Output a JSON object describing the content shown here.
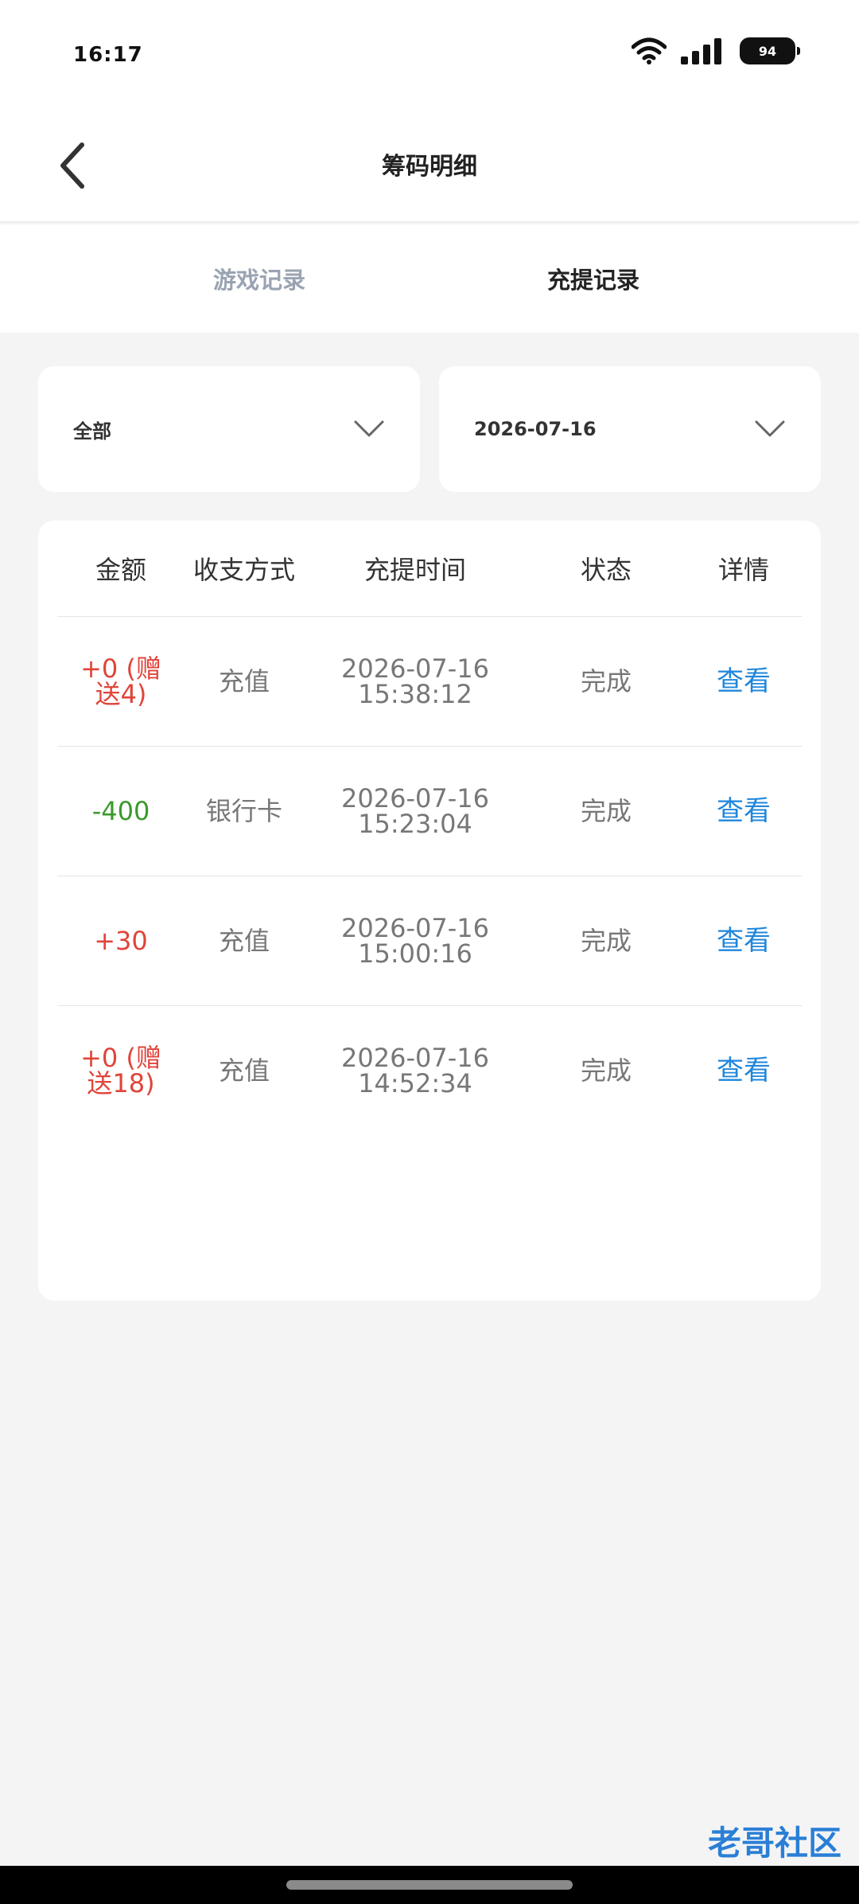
{
  "status_bar": {
    "time": "16:17",
    "battery": "94"
  },
  "header": {
    "title": "筹码明细"
  },
  "tabs": [
    {
      "label": "游戏记录",
      "active": false
    },
    {
      "label": "充提记录",
      "active": true
    }
  ],
  "filters": {
    "type_selected": "全部",
    "date_selected": "2026-07-16"
  },
  "table": {
    "headers": [
      "金额",
      "收支方式",
      "充提时间",
      "状态",
      "详情"
    ],
    "rows": [
      {
        "amount": "+0 (赠送4)",
        "amount_line1": "+0 (赠",
        "amount_line2": "送4)",
        "method": "充值",
        "date": "2026-07-16",
        "time": "15:38:12",
        "status": "完成",
        "detail": "查看",
        "amount_color": "red"
      },
      {
        "amount": "-400",
        "amount_line1": "-400",
        "amount_line2": "",
        "method": "银行卡",
        "date": "2026-07-16",
        "time": "15:23:04",
        "status": "完成",
        "detail": "查看",
        "amount_color": "green"
      },
      {
        "amount": "+30",
        "amount_line1": "+30",
        "amount_line2": "",
        "method": "充值",
        "date": "2026-07-16",
        "time": "15:00:16",
        "status": "完成",
        "detail": "查看",
        "amount_color": "red"
      },
      {
        "amount": "+0 (赠送18)",
        "amount_line1": "+0 (赠",
        "amount_line2": "送18)",
        "method": "充值",
        "date": "2026-07-16",
        "time": "14:52:34",
        "status": "完成",
        "detail": "查看",
        "amount_color": "red"
      }
    ]
  },
  "watermark": {
    "text": "老哥社区"
  },
  "colors": {
    "accent_link": "#1f86dc",
    "positive_red": "#e0443a",
    "negative_green": "#3a9a2a",
    "page_bg": "#f4f4f5"
  }
}
